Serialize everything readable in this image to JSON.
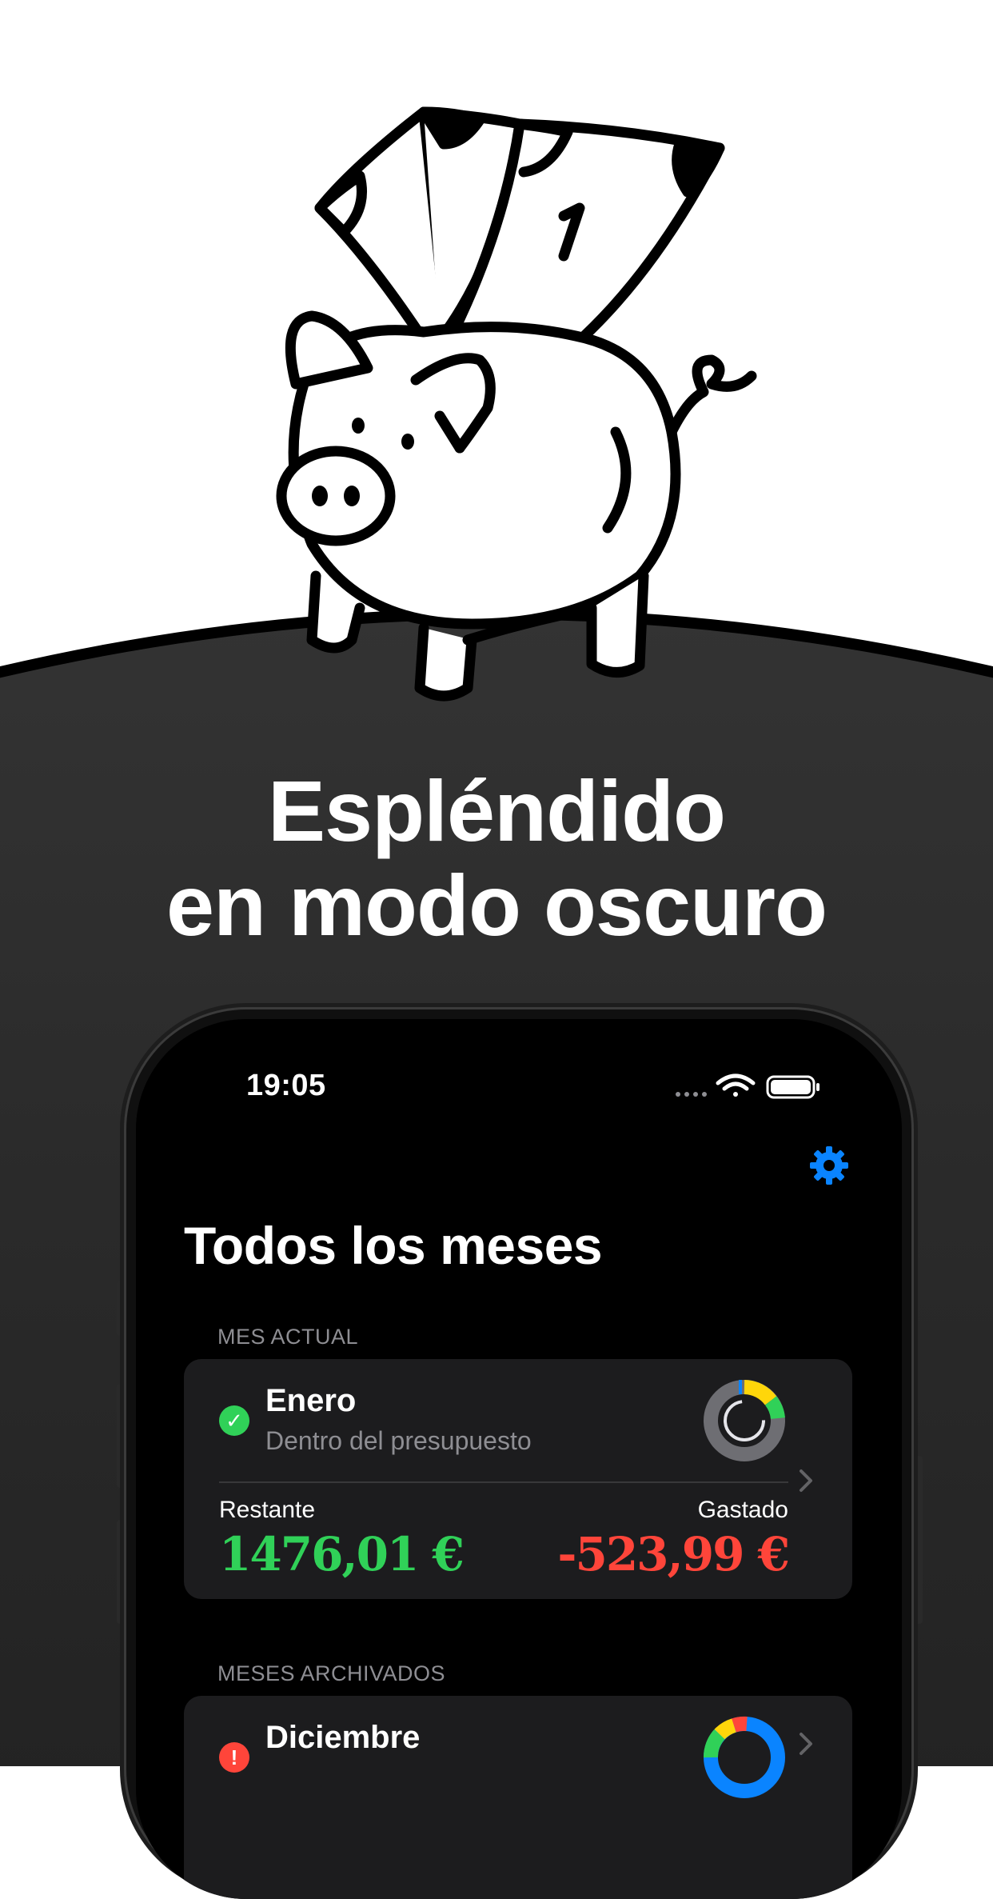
{
  "headline": {
    "line1": "Espléndido",
    "line2": "en modo oscuro"
  },
  "status_bar": {
    "time": "19:05"
  },
  "screen": {
    "title": "Todos los meses",
    "current_section": {
      "label": "MES ACTUAL",
      "card": {
        "name": "Enero",
        "status": "Dentro del presupuesto",
        "remaining_label": "Restante",
        "remaining_value": "1476,01 €",
        "spent_label": "Gastado",
        "spent_value": "-523,99 €"
      }
    },
    "archived_section": {
      "label": "MESES ARCHIVADOS",
      "card": {
        "name": "Diciembre"
      }
    }
  },
  "colors": {
    "accent_blue": "#0a84ff",
    "positive_green": "#30d158",
    "negative_red": "#ff453a",
    "background_dark": "#2c2c2c"
  },
  "icons": {
    "status_ok": "checkmark-circle-icon",
    "status_warning": "exclamation-circle-icon",
    "settings": "gear-icon"
  }
}
